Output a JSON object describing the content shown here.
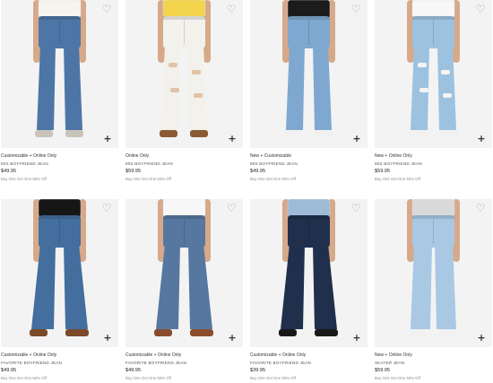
{
  "icons": {
    "favorite": "heart-outline-icon",
    "quick_add": "plus-icon"
  },
  "products": [
    {
      "badge": "Customizable + Online Only",
      "name": "90S BOYFRIEND JEAN",
      "price": "$49.95",
      "promo": "Buy One Get One 50% Off",
      "top_color": "#f7f4ef",
      "denim": "#4d76a6",
      "shoe": "#c9c3ba",
      "style": "straight"
    },
    {
      "badge": "Online Only",
      "name": "90S BOYFRIEND JEAN",
      "price": "$59.95",
      "promo": "Buy One Get One 50% Off",
      "top_color": "#f2d44d",
      "denim": "#f3f1ec",
      "shoe": "#8a5a34",
      "style": "white-ripped"
    },
    {
      "badge": "New + Customizable",
      "name": "90S BOYFRIEND JEAN",
      "price": "$49.95",
      "promo": "Buy One Get One 50% Off",
      "top_color": "#1b1b1b",
      "denim": "#7ea8cf",
      "shoe": "#f1f1f1",
      "style": "straight"
    },
    {
      "badge": "New + Online Only",
      "name": "90S BOYFRIEND JEAN",
      "price": "$59.95",
      "promo": "Buy One Get One 50% Off",
      "top_color": "#f7f7f7",
      "denim": "#9cc2e0",
      "shoe": "#f1f1f1",
      "style": "ripped"
    },
    {
      "badge": "Customizable + Online Only",
      "name": "FAVORITE BOYFRIEND JEAN",
      "price": "$49.95",
      "promo": "Buy One Get One 50% Off",
      "top_color": "#161616",
      "denim": "#436e9e",
      "shoe": "#7a4a2a",
      "style": "flare"
    },
    {
      "badge": "Customizable + Online Only",
      "name": "FAVORITE BOYFRIEND JEAN",
      "price": "$49.95",
      "promo": "Buy One Get One 50% Off",
      "top_color": "#f7f7f7",
      "denim": "#5677a0",
      "shoe": "#8a4c2c",
      "style": "flare"
    },
    {
      "badge": "Customizable + Online Only",
      "name": "FAVORITE BOYFRIEND JEAN",
      "price": "$39.95",
      "promo": "Buy One Get One 50% Off",
      "top_color": "#9dbad6",
      "denim": "#1f2f4c",
      "shoe": "#181818",
      "style": "flare"
    },
    {
      "badge": "New + Online Only",
      "name": "SKATER JEAN",
      "price": "$59.95",
      "promo": "Buy One Get One 50% Off",
      "top_color": "#d9d9d9",
      "denim": "#a9c8e4",
      "shoe": "#f1f1f1",
      "style": "wide"
    }
  ]
}
